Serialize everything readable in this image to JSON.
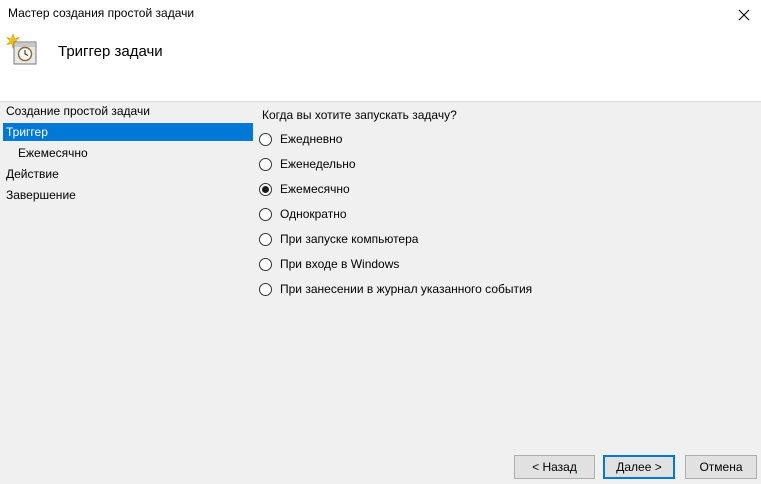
{
  "window": {
    "title": "Мастер создания простой задачи",
    "close_icon": "close-icon"
  },
  "header": {
    "title": "Триггер задачи",
    "icon": "task-scheduler-icon"
  },
  "nav": {
    "items": [
      {
        "label": "Создание простой задачи"
      },
      {
        "label": "Триггер",
        "selected": true
      },
      {
        "label": "Ежемесячно",
        "sub": true
      },
      {
        "label": "Действие"
      },
      {
        "label": "Завершение"
      }
    ]
  },
  "main": {
    "question": "Когда вы хотите запускать задачу?",
    "options": [
      {
        "label": "Ежедневно",
        "checked": false
      },
      {
        "label": "Еженедельно",
        "checked": false
      },
      {
        "label": "Ежемесячно",
        "checked": true
      },
      {
        "label": "Однократно",
        "checked": false
      },
      {
        "label": "При запуске компьютера",
        "checked": false
      },
      {
        "label": "При входе в Windows",
        "checked": false
      },
      {
        "label": "При занесении в журнал указанного события",
        "checked": false
      }
    ]
  },
  "buttons": {
    "back": "< Назад",
    "next": "Далее >",
    "cancel": "Отмена"
  },
  "colors": {
    "selection": "#0078d7",
    "background": "#f0f0f0",
    "header_bg": "#ffffff"
  }
}
